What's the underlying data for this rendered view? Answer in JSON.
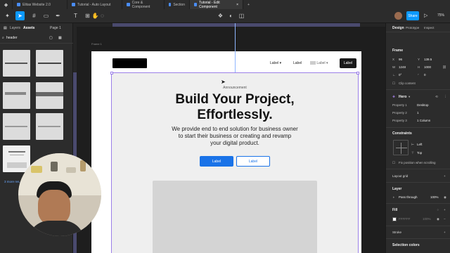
{
  "tabs": [
    "Elitas Website 2.0",
    "Tutorial - Auto Layout",
    "Core & Component",
    "Section",
    "Tutorial - Edit Component"
  ],
  "share_label": "Share",
  "zoom": "75%",
  "left": {
    "layers_tab": "Layers",
    "assets_tab": "Assets",
    "page_label": "Page 1",
    "search_value": "header",
    "more_results": "3 more res..."
  },
  "canvas": {
    "frame_label": "Frame 1",
    "nav": {
      "label1": "Label",
      "label2": "Label",
      "label3": "Label",
      "button": "Label"
    },
    "hero": {
      "announcement": "Announcement",
      "title_line1": "Build Your Project,",
      "title_line2": "Effortlessly.",
      "desc_line1": "We provide end to end solution for business owner",
      "desc_line2": "to start their business or creating and revamp",
      "desc_line3": "your digital product.",
      "primary_button": "Label",
      "secondary_button": "Label"
    }
  },
  "right": {
    "tabs": {
      "design": "Design",
      "prototype": "Prototype",
      "inspect": "Inspect"
    },
    "frame_title": "Frame",
    "x_value": "96",
    "y_value": "139.5",
    "w_value": "1248",
    "h_value": "1000",
    "rotation": "0°",
    "radius": "0",
    "clip_content": "Clip content",
    "component_name": "Hero",
    "props": [
      {
        "name": "Property 1",
        "value": "Desktop"
      },
      {
        "name": "Property 2",
        "value": "1"
      },
      {
        "name": "Property 3",
        "value": "1 Column"
      }
    ],
    "constraints_title": "Constraints",
    "constraint_h": "Left",
    "constraint_v": "Top",
    "fix_position": "Fix position when scrolling",
    "layout_grid": "Layout grid",
    "layer_title": "Layer",
    "pass_through": "Pass through",
    "layer_opacity": "100%",
    "fill_title": "Fill",
    "fill_hex": "FFFFFF",
    "fill_opacity": "100%",
    "stroke_title": "Stroke",
    "selection_colors": "Selection colors"
  },
  "colors": {
    "accent": "#0d99ff",
    "selection": "#9b7fe8",
    "primary_btn": "#1a73e8"
  }
}
